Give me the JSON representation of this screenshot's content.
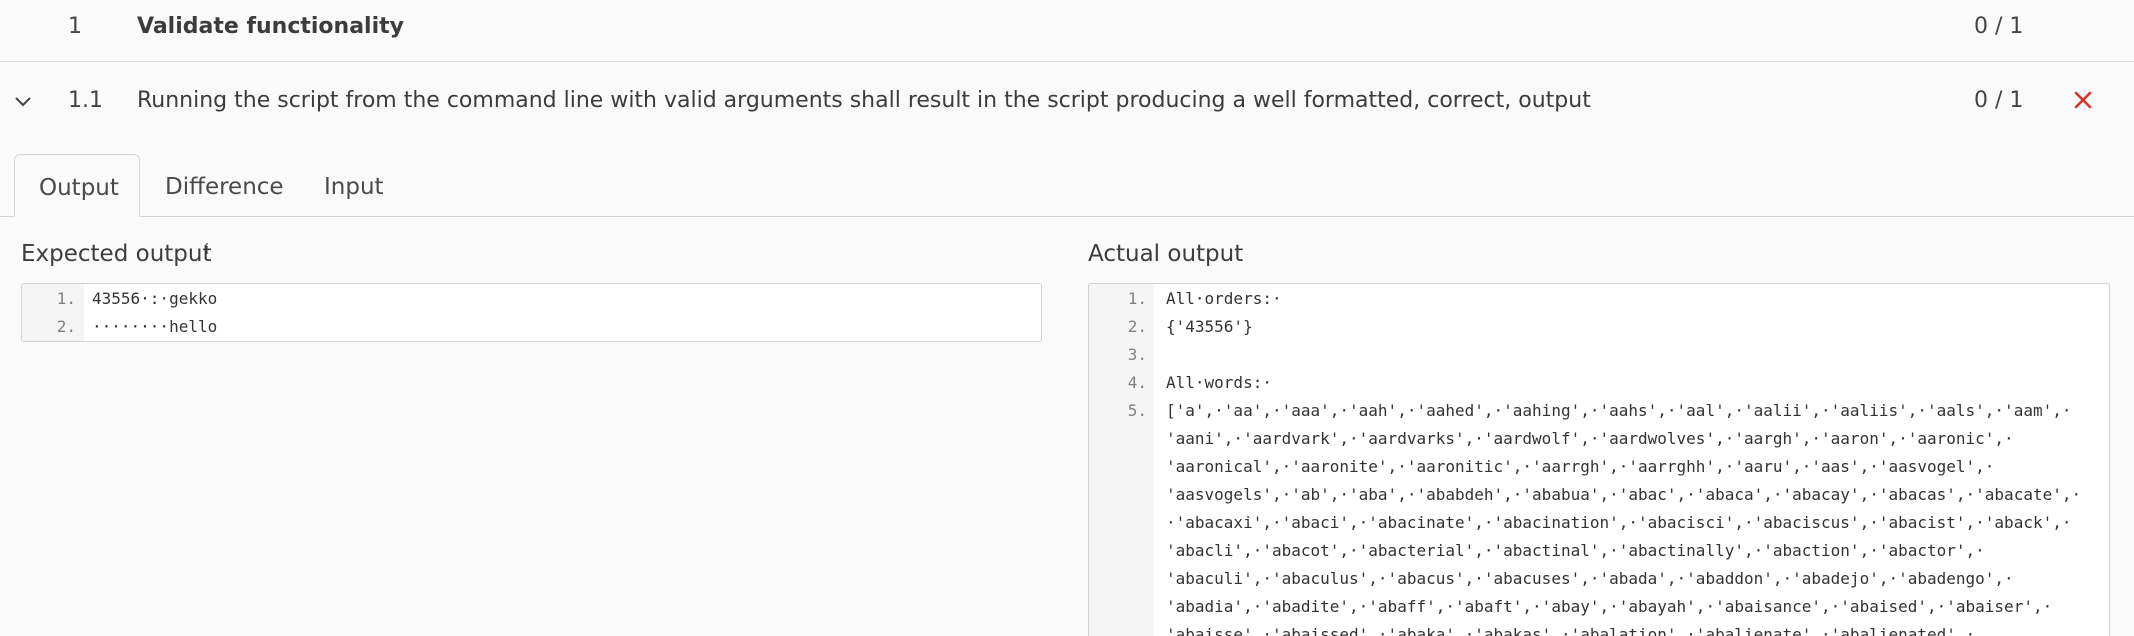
{
  "group": {
    "number": "1",
    "title": "Validate functionality",
    "score": "0 / 1"
  },
  "test": {
    "number": "1.1",
    "title": "Running the script from the command line with valid arguments shall result in the script producing a well formatted, correct, output",
    "score": "0 / 1",
    "status_icon": "close-icon",
    "status_color": "#e0302a"
  },
  "tabs": [
    {
      "label": "Output",
      "active": true
    },
    {
      "label": "Difference",
      "active": false
    },
    {
      "label": "Input",
      "active": false
    }
  ],
  "expected": {
    "label": "Expected output",
    "info_glyph": "i",
    "lines": [
      {
        "n": "1.",
        "text": "43556·:·gekko"
      },
      {
        "n": "2.",
        "text": "········hello"
      }
    ]
  },
  "actual": {
    "label": "Actual output",
    "lines": [
      {
        "n": "1.",
        "text": "All·orders:·"
      },
      {
        "n": "2.",
        "text": "{'43556'}"
      },
      {
        "n": "3.",
        "text": ""
      },
      {
        "n": "4.",
        "text": "All·words:·"
      },
      {
        "n": "5.",
        "text": "['a',·'aa',·'aaa',·'aah',·'aahed',·'aahing',·'aahs',·'aal',·'aalii',·'aaliis',·'aals',·'aam',·"
      },
      {
        "n": "",
        "text": "'aani',·'aardvark',·'aardvarks',·'aardwolf',·'aardwolves',·'aargh',·'aaron',·'aaronic',·"
      },
      {
        "n": "",
        "text": "'aaronical',·'aaronite',·'aaronitic',·'aarrgh',·'aarrghh',·'aaru',·'aas',·'aasvogel',·"
      },
      {
        "n": "",
        "text": "'aasvogels',·'ab',·'aba',·'ababdeh',·'ababua',·'abac',·'abaca',·'abacay',·'abacas',·'abacate',·"
      },
      {
        "n": "",
        "text": "·'abacaxi',·'abaci',·'abacinate',·'abacination',·'abacisci',·'abaciscus',·'abacist',·'aback',·"
      },
      {
        "n": "",
        "text": "'abacli',·'abacot',·'abacterial',·'abactinal',·'abactinally',·'abaction',·'abactor',·"
      },
      {
        "n": "",
        "text": "'abaculi',·'abaculus',·'abacus',·'abacuses',·'abada',·'abaddon',·'abadejo',·'abadengo',·"
      },
      {
        "n": "",
        "text": "'abadia',·'abadite',·'abaff',·'abaft',·'abay',·'abayah',·'abaisance',·'abaised',·'abaiser',·"
      },
      {
        "n": "",
        "text": "'abaisse',·'abaissed',·'abaka',·'abakas',·'abalation',·'abalienate',·'abalienated',·"
      }
    ]
  }
}
